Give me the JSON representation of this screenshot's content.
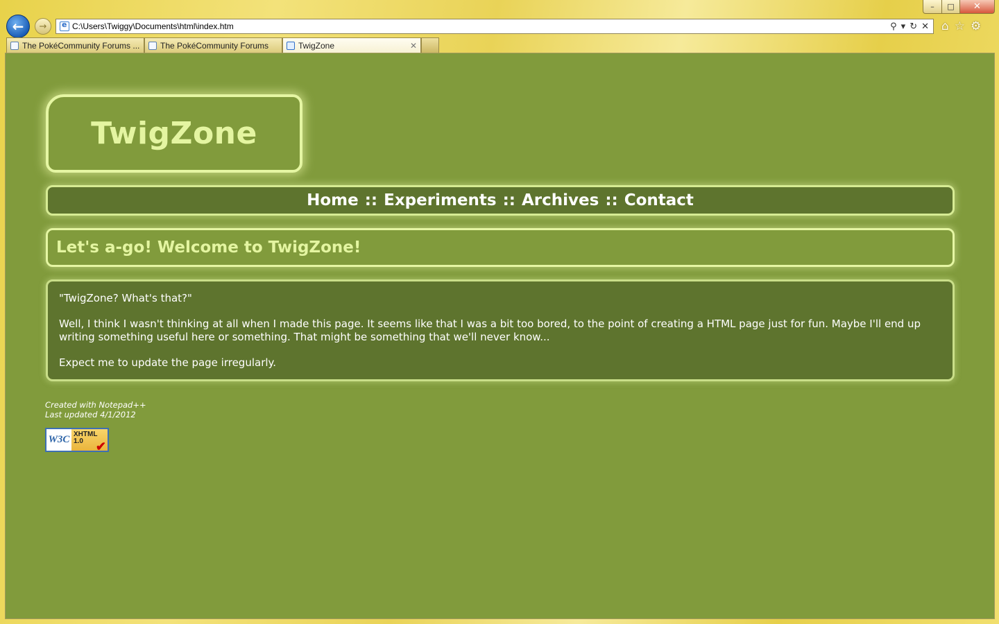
{
  "browser": {
    "address": "C:\\Users\\Twiggy\\Documents\\html\\index.htm",
    "tabs": [
      {
        "label": "The PokéCommunity Forums ..."
      },
      {
        "label": "The PokéCommunity Forums"
      },
      {
        "label": "TwigZone"
      }
    ],
    "window_controls": {
      "minimize": "–",
      "maximize": "□",
      "close": "✕"
    }
  },
  "page": {
    "logo": "TwigZone",
    "nav": {
      "items": [
        "Home",
        "Experiments",
        "Archives",
        "Contact"
      ],
      "separator": "::"
    },
    "welcome": "Let's a-go! Welcome to TwigZone!",
    "paragraphs": [
      "\"TwigZone? What's that?\"",
      "Well, I think I wasn't thinking at all when I made this page. It seems like that I was a bit too bored, to the point of creating a HTML page just for fun. Maybe I'll end up writing something useful here or something. That might be something that we'll never know...",
      "Expect me to update the page irregularly."
    ],
    "footer": {
      "line1": "Created with Notepad++",
      "line2": "Last updated 4/1/2012"
    },
    "badge": {
      "left": "W3C",
      "line1": "XHTML",
      "line2": "1.0",
      "check": "✔"
    }
  },
  "colors": {
    "page_background": "#819b3c",
    "panel_dark": "#5e742e",
    "accent_light": "#e4f5a1"
  }
}
